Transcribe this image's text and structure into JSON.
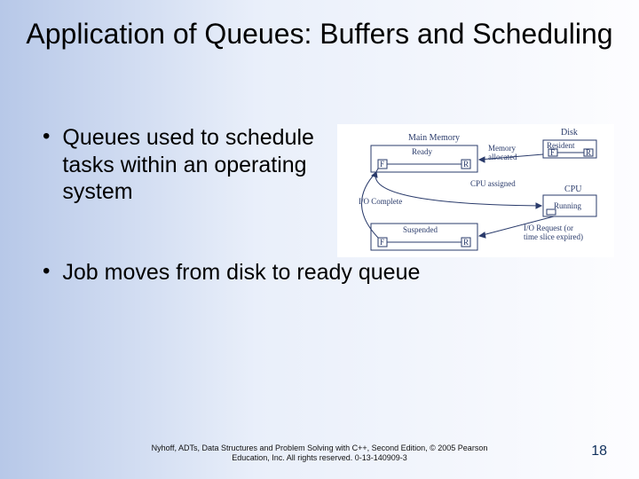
{
  "title": "Application of Queues: Buffers and Scheduling",
  "bullets": [
    "Queues used to schedule tasks within an operating system",
    "Job moves from disk to ready queue"
  ],
  "diagram": {
    "top": {
      "mainMemory": "Main Memory",
      "ready": "Ready",
      "memAllocated": "Memory allocated",
      "disk": "Disk",
      "resident": "Resident",
      "f": "F",
      "r": "R"
    },
    "mid": {
      "cpuAssigned": "CPU assigned",
      "cpu": "CPU",
      "running": "Running"
    },
    "bot": {
      "ioComplete": "I/O Complete",
      "suspended": "Suspended",
      "ioRequest": "I/O Request (or time slice expired)",
      "f": "F",
      "r": "R"
    }
  },
  "footer_line1": "Nyhoff, ADTs, Data Structures and Problem Solving with C++, Second Edition, © 2005 Pearson",
  "footer_line2": "Education, Inc. All rights reserved. 0-13-140909-3",
  "page_number": "18"
}
